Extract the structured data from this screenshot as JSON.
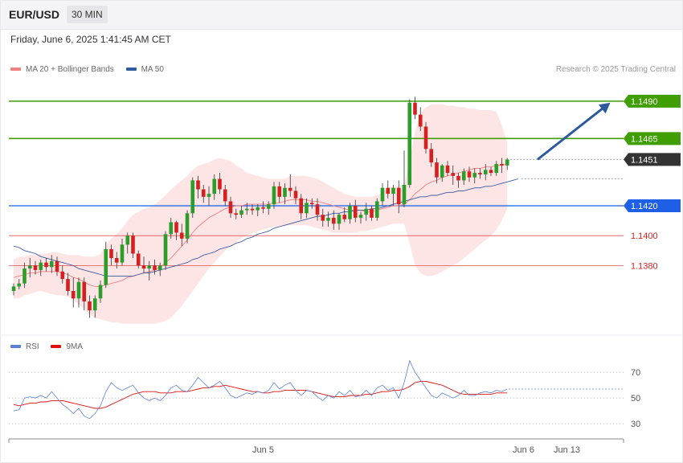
{
  "header": {
    "symbol": "EUR/USD",
    "timeframe": "30 MIN"
  },
  "datetime": "Friday, June 6, 2025 1:41:45 AM CET",
  "legend": [
    {
      "label": "MA 20 + Bollinger Bands",
      "color": "#f08080"
    },
    {
      "label": "MA 50",
      "color": "#2e5c9e"
    }
  ],
  "rsi_legend": [
    {
      "label": "RSI",
      "color": "#5b7fd6"
    },
    {
      "label": "9MA",
      "color": "#e01010"
    }
  ],
  "credit": "Research © 2025 Trading Central",
  "colors": {
    "up": "#2a9d2a",
    "down": "#d62020",
    "resistance": "#3f9e00",
    "support": "#1e5fe6",
    "level": "#e05050",
    "last": "#333333",
    "band": "#fcdcdc"
  },
  "chart_data": [
    {
      "type": "candlestick",
      "ylim": [
        1.1335,
        1.1505
      ],
      "x_ticks": [
        {
          "label": "Jun 5",
          "index": 46
        },
        {
          "label": "Jun 6",
          "index": 94
        },
        {
          "label": "Jun 13",
          "index": 102
        }
      ],
      "levels": [
        {
          "label": "1.1490",
          "value": 1.149,
          "kind": "resistance"
        },
        {
          "label": "1.1465",
          "value": 1.1465,
          "kind": "resistance"
        },
        {
          "label": "1.1451",
          "value": 1.1451,
          "kind": "last"
        },
        {
          "label": "1.1420",
          "value": 1.142,
          "kind": "support"
        },
        {
          "label": "1.1400",
          "value": 1.14,
          "kind": "level"
        },
        {
          "label": "1.1380",
          "value": 1.138,
          "kind": "level"
        }
      ],
      "projection": {
        "from": [
          96,
          1.1451
        ],
        "to": [
          110,
          1.1489
        ]
      },
      "candles": [
        [
          1.1363,
          1.1368,
          1.136,
          1.1366
        ],
        [
          1.1366,
          1.1371,
          1.1364,
          1.1368
        ],
        [
          1.1368,
          1.1382,
          1.1365,
          1.1378
        ],
        [
          1.1378,
          1.1385,
          1.1372,
          1.138
        ],
        [
          1.138,
          1.1383,
          1.1374,
          1.1377
        ],
        [
          1.1377,
          1.1384,
          1.1373,
          1.1382
        ],
        [
          1.1382,
          1.1385,
          1.1376,
          1.1379
        ],
        [
          1.1379,
          1.1387,
          1.1375,
          1.1383
        ],
        [
          1.1383,
          1.1386,
          1.1373,
          1.1376
        ],
        [
          1.1376,
          1.138,
          1.1368,
          1.1371
        ],
        [
          1.1371,
          1.1375,
          1.136,
          1.1363
        ],
        [
          1.1363,
          1.1372,
          1.1352,
          1.1358
        ],
        [
          1.1358,
          1.1372,
          1.1352,
          1.1369
        ],
        [
          1.1369,
          1.1372,
          1.135,
          1.1356
        ],
        [
          1.1356,
          1.136,
          1.1345,
          1.135
        ],
        [
          1.135,
          1.136,
          1.1345,
          1.1358
        ],
        [
          1.1358,
          1.137,
          1.1355,
          1.1367
        ],
        [
          1.1367,
          1.1396,
          1.1365,
          1.1391
        ],
        [
          1.1391,
          1.1394,
          1.138,
          1.1385
        ],
        [
          1.1385,
          1.1389,
          1.1378,
          1.1382
        ],
        [
          1.1382,
          1.1398,
          1.138,
          1.1394
        ],
        [
          1.1394,
          1.1402,
          1.1388,
          1.14
        ],
        [
          1.14,
          1.1402,
          1.1385,
          1.1388
        ],
        [
          1.1388,
          1.139,
          1.1378,
          1.138
        ],
        [
          1.138,
          1.1386,
          1.1375,
          1.1378
        ],
        [
          1.1378,
          1.1383,
          1.137,
          1.138
        ],
        [
          1.138,
          1.1384,
          1.1374,
          1.1377
        ],
        [
          1.1377,
          1.1382,
          1.1373,
          1.138
        ],
        [
          1.138,
          1.1403,
          1.1377,
          1.1401
        ],
        [
          1.1401,
          1.1412,
          1.1398,
          1.1409
        ],
        [
          1.1409,
          1.141,
          1.1397,
          1.1402
        ],
        [
          1.1402,
          1.1408,
          1.1393,
          1.1398
        ],
        [
          1.1398,
          1.1417,
          1.1395,
          1.1415
        ],
        [
          1.1415,
          1.1439,
          1.1412,
          1.1437
        ],
        [
          1.1437,
          1.144,
          1.1425,
          1.1431
        ],
        [
          1.1431,
          1.1434,
          1.1422,
          1.1426
        ],
        [
          1.1426,
          1.1433,
          1.142,
          1.1428
        ],
        [
          1.1428,
          1.1441,
          1.1424,
          1.1438
        ],
        [
          1.1438,
          1.1442,
          1.1428,
          1.1431
        ],
        [
          1.1431,
          1.1434,
          1.142,
          1.1423
        ],
        [
          1.1423,
          1.1426,
          1.1412,
          1.1415
        ],
        [
          1.1415,
          1.1418,
          1.1411,
          1.1414
        ],
        [
          1.1414,
          1.142,
          1.1412,
          1.1417
        ],
        [
          1.1417,
          1.1422,
          1.1414,
          1.1418
        ],
        [
          1.1418,
          1.1421,
          1.1414,
          1.1417
        ],
        [
          1.1417,
          1.1421,
          1.1413,
          1.1419
        ],
        [
          1.1419,
          1.1423,
          1.1415,
          1.1418
        ],
        [
          1.1418,
          1.1423,
          1.1414,
          1.1421
        ],
        [
          1.1421,
          1.1436,
          1.1418,
          1.1433
        ],
        [
          1.1433,
          1.1436,
          1.1422,
          1.1426
        ],
        [
          1.1426,
          1.1435,
          1.1421,
          1.1432
        ],
        [
          1.1432,
          1.1441,
          1.1426,
          1.143
        ],
        [
          1.143,
          1.1433,
          1.1421,
          1.1425
        ],
        [
          1.1425,
          1.1428,
          1.1411,
          1.1415
        ],
        [
          1.1415,
          1.1425,
          1.1412,
          1.1422
        ],
        [
          1.1422,
          1.1425,
          1.1418,
          1.1421
        ],
        [
          1.1421,
          1.1425,
          1.141,
          1.1414
        ],
        [
          1.1414,
          1.1418,
          1.1406,
          1.141
        ],
        [
          1.141,
          1.1416,
          1.1406,
          1.1412
        ],
        [
          1.1412,
          1.1417,
          1.1404,
          1.1408
        ],
        [
          1.1408,
          1.1415,
          1.1404,
          1.1414
        ],
        [
          1.1414,
          1.1419,
          1.1409,
          1.1411
        ],
        [
          1.1411,
          1.1422,
          1.1408,
          1.142
        ],
        [
          1.142,
          1.1424,
          1.1409,
          1.1412
        ],
        [
          1.1412,
          1.1416,
          1.1408,
          1.1414
        ],
        [
          1.1414,
          1.1422,
          1.141,
          1.1418
        ],
        [
          1.1418,
          1.142,
          1.141,
          1.1412
        ],
        [
          1.1412,
          1.1425,
          1.141,
          1.1423
        ],
        [
          1.1423,
          1.1435,
          1.142,
          1.1432
        ],
        [
          1.1432,
          1.1437,
          1.1425,
          1.1428
        ],
        [
          1.1428,
          1.1434,
          1.142,
          1.1432
        ],
        [
          1.1432,
          1.1437,
          1.1415,
          1.1421
        ],
        [
          1.1421,
          1.1457,
          1.1419,
          1.1434
        ],
        [
          1.1434,
          1.1491,
          1.1432,
          1.1489
        ],
        [
          1.1489,
          1.1493,
          1.1478,
          1.1481
        ],
        [
          1.1481,
          1.1486,
          1.147,
          1.1473
        ],
        [
          1.1473,
          1.1476,
          1.1455,
          1.1458
        ],
        [
          1.1458,
          1.1462,
          1.1446,
          1.1449
        ],
        [
          1.1449,
          1.1452,
          1.1435,
          1.1439
        ],
        [
          1.1439,
          1.1448,
          1.1436,
          1.1447
        ],
        [
          1.1447,
          1.145,
          1.144,
          1.1442
        ],
        [
          1.1442,
          1.1447,
          1.1434,
          1.144
        ],
        [
          1.144,
          1.1442,
          1.1432,
          1.1437
        ],
        [
          1.1437,
          1.1445,
          1.1434,
          1.1443
        ],
        [
          1.1443,
          1.1446,
          1.1436,
          1.1439
        ],
        [
          1.1439,
          1.1445,
          1.1435,
          1.1442
        ],
        [
          1.1442,
          1.1445,
          1.1438,
          1.1441
        ],
        [
          1.1441,
          1.1448,
          1.1437,
          1.1444
        ],
        [
          1.1444,
          1.1446,
          1.144,
          1.1442
        ],
        [
          1.1442,
          1.145,
          1.144,
          1.1448
        ],
        [
          1.1448,
          1.1452,
          1.1442,
          1.1447
        ],
        [
          1.1447,
          1.1452,
          1.1444,
          1.1451
        ]
      ],
      "ma20": [
        1.1372,
        1.1373,
        1.1374,
        1.1375,
        1.1375,
        1.1376,
        1.1376,
        1.1376,
        1.1376,
        1.1375,
        1.1374,
        1.1372,
        1.1371,
        1.1369,
        1.1367,
        1.1366,
        1.1366,
        1.1367,
        1.1368,
        1.1369,
        1.137,
        1.1372,
        1.1373,
        1.1374,
        1.1375,
        1.1376,
        1.1377,
        1.1379,
        1.1382,
        1.1385,
        1.1389,
        1.1393,
        1.1397,
        1.1402,
        1.1406,
        1.1409,
        1.1412,
        1.1414,
        1.1416,
        1.1418,
        1.1419,
        1.142,
        1.142,
        1.1421,
        1.1421,
        1.1421,
        1.1421,
        1.1421,
        1.1422,
        1.1422,
        1.1423,
        1.1424,
        1.1424,
        1.1424,
        1.1424,
        1.1423,
        1.1423,
        1.1422,
        1.1421,
        1.142,
        1.1419,
        1.1418,
        1.1417,
        1.1417,
        1.1417,
        1.1416,
        1.1416,
        1.1417,
        1.1418,
        1.1419,
        1.142,
        1.142,
        1.1421,
        1.1424,
        1.1428,
        1.1431,
        1.1434,
        1.1436,
        1.1437,
        1.1439,
        1.144,
        1.1441,
        1.1442,
        1.1443,
        1.1444,
        1.1445,
        1.1445,
        1.1446,
        1.1446,
        1.1447,
        1.1447,
        1.1448
      ],
      "ma50": [
        1.1393,
        1.1392,
        1.139,
        1.1389,
        1.1388,
        1.1386,
        1.1385,
        1.1384,
        1.1383,
        1.1382,
        1.1381,
        1.138,
        1.1378,
        1.1377,
        1.1376,
        1.1375,
        1.1374,
        1.1373,
        1.1373,
        1.1373,
        1.1373,
        1.1373,
        1.1373,
        1.1374,
        1.1375,
        1.1375,
        1.1376,
        1.1377,
        1.1378,
        1.1379,
        1.138,
        1.1381,
        1.1382,
        1.1384,
        1.1385,
        1.1387,
        1.1388,
        1.1389,
        1.1391,
        1.1392,
        1.1393,
        1.1395,
        1.1396,
        1.1398,
        1.1399,
        1.1401,
        1.1402,
        1.1403,
        1.1405,
        1.1406,
        1.1407,
        1.1408,
        1.1409,
        1.141,
        1.1411,
        1.1412,
        1.1413,
        1.1413,
        1.1414,
        1.1415,
        1.1415,
        1.1416,
        1.1416,
        1.1417,
        1.1417,
        1.1417,
        1.1418,
        1.1418,
        1.1419,
        1.142,
        1.1421,
        1.1422,
        1.1423,
        1.1424,
        1.1425,
        1.1426,
        1.1426,
        1.1427,
        1.1427,
        1.1428,
        1.1429,
        1.1429,
        1.143,
        1.143,
        1.1431,
        1.1432,
        1.1432,
        1.1433,
        1.1433,
        1.1434,
        1.1435,
        1.1436,
        1.1437,
        1.1438
      ],
      "bb_upper": [
        1.1384,
        1.1386,
        1.1386,
        1.1387,
        1.1387,
        1.1388,
        1.1388,
        1.1389,
        1.1389,
        1.1388,
        1.1387,
        1.1387,
        1.1387,
        1.1386,
        1.1386,
        1.1386,
        1.1388,
        1.1394,
        1.1398,
        1.1401,
        1.1405,
        1.141,
        1.1414,
        1.1416,
        1.1418,
        1.1419,
        1.1421,
        1.1424,
        1.1427,
        1.1431,
        1.1434,
        1.1437,
        1.144,
        1.1444,
        1.1447,
        1.1448,
        1.1449,
        1.1451,
        1.1452,
        1.1451,
        1.145,
        1.1447,
        1.1445,
        1.1442,
        1.1441,
        1.144,
        1.1439,
        1.1438,
        1.1438,
        1.1438,
        1.1438,
        1.144,
        1.144,
        1.144,
        1.144,
        1.1439,
        1.1438,
        1.1436,
        1.1434,
        1.1432,
        1.143,
        1.1428,
        1.1427,
        1.1426,
        1.1426,
        1.1426,
        1.1426,
        1.1427,
        1.1429,
        1.1432,
        1.1433,
        1.1433,
        1.1434,
        1.145,
        1.147,
        1.1482,
        1.1486,
        1.1488,
        1.1488,
        1.1488,
        1.1487,
        1.1487,
        1.1486,
        1.1486,
        1.1485,
        1.1485,
        1.1484,
        1.1484,
        1.1484,
        1.1483,
        1.1474,
        1.1462
      ],
      "bb_lower": [
        1.1358,
        1.1358,
        1.136,
        1.1361,
        1.1362,
        1.1363,
        1.1362,
        1.1361,
        1.136,
        1.136,
        1.1359,
        1.1357,
        1.1354,
        1.1351,
        1.1347,
        1.1345,
        1.1344,
        1.1343,
        1.1342,
        1.1342,
        1.1341,
        1.1341,
        1.1341,
        1.1341,
        1.1341,
        1.1341,
        1.1341,
        1.1342,
        1.1343,
        1.1345,
        1.1349,
        1.1353,
        1.1358,
        1.1363,
        1.1368,
        1.1373,
        1.1378,
        1.1382,
        1.1386,
        1.139,
        1.1393,
        1.1396,
        1.1398,
        1.14,
        1.1402,
        1.1403,
        1.1404,
        1.1405,
        1.1406,
        1.1406,
        1.1407,
        1.1407,
        1.1407,
        1.1407,
        1.1407,
        1.1406,
        1.1405,
        1.1404,
        1.1403,
        1.1402,
        1.1402,
        1.1402,
        1.1402,
        1.1402,
        1.1403,
        1.1403,
        1.1404,
        1.1405,
        1.1406,
        1.1407,
        1.1408,
        1.1408,
        1.1408,
        1.1395,
        1.138,
        1.1375,
        1.1373,
        1.1373,
        1.1374,
        1.1376,
        1.1378,
        1.138,
        1.1382,
        1.1385,
        1.1388,
        1.1391,
        1.1394,
        1.1397,
        1.14,
        1.1404,
        1.141,
        1.1418
      ]
    },
    {
      "type": "line",
      "title": "RSI",
      "y_ticks": [
        30,
        50,
        70
      ],
      "ylim": [
        22,
        82
      ],
      "series": [
        {
          "name": "RSI",
          "values": [
            40,
            41,
            50,
            51,
            50,
            52,
            50,
            55,
            50,
            45,
            42,
            38,
            42,
            36,
            34,
            38,
            44,
            55,
            62,
            58,
            56,
            58,
            60,
            54,
            50,
            48,
            50,
            48,
            52,
            58,
            60,
            56,
            55,
            60,
            66,
            62,
            58,
            60,
            63,
            58,
            52,
            50,
            52,
            54,
            53,
            55,
            54,
            56,
            62,
            57,
            60,
            62,
            56,
            52,
            56,
            55,
            51,
            48,
            52,
            50,
            55,
            52,
            56,
            51,
            52,
            56,
            52,
            58,
            60,
            56,
            58,
            50,
            62,
            79,
            70,
            64,
            58,
            52,
            50,
            54,
            52,
            50,
            52,
            56,
            52,
            52,
            54,
            55,
            54,
            56,
            55,
            57
          ]
        },
        {
          "name": "9MA",
          "values": [
            45,
            44,
            45,
            46,
            46,
            47,
            47,
            48,
            48,
            48,
            47,
            46,
            45,
            44,
            43,
            42,
            42,
            43,
            45,
            47,
            49,
            51,
            53,
            54,
            55,
            55,
            55,
            54,
            54,
            54,
            55,
            55,
            55,
            56,
            57,
            58,
            58,
            59,
            59,
            60,
            59,
            58,
            57,
            56,
            55,
            55,
            54,
            54,
            55,
            55,
            56,
            56,
            56,
            56,
            56,
            55,
            54,
            53,
            52,
            51,
            51,
            51,
            52,
            52,
            52,
            53,
            53,
            54,
            55,
            55,
            56,
            56,
            57,
            59,
            62,
            63,
            63,
            62,
            61,
            60,
            58,
            56,
            54,
            53,
            53,
            53,
            53,
            53,
            53,
            54,
            54,
            54
          ]
        }
      ]
    }
  ]
}
